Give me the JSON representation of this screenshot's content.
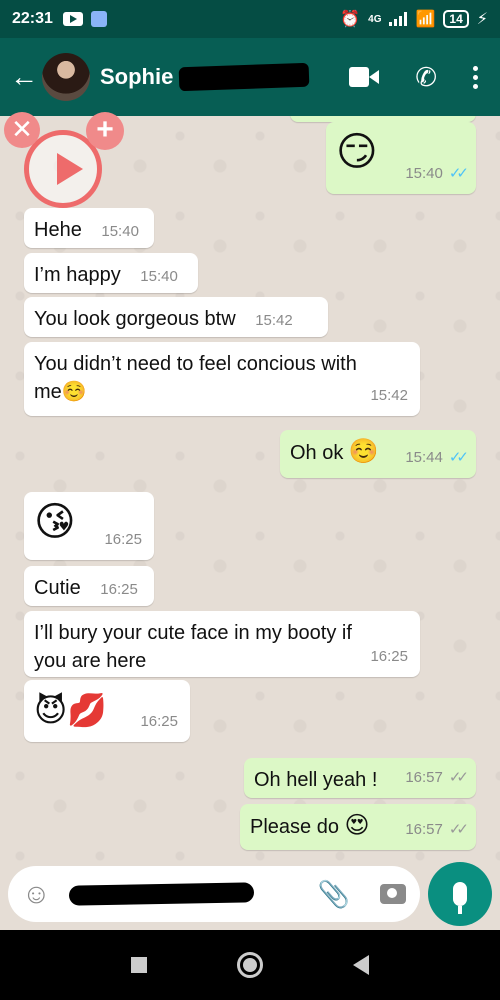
{
  "status_bar": {
    "time": "22:31",
    "network": "4G",
    "battery": "14"
  },
  "header": {
    "contact_name": "Sophie"
  },
  "messages": [
    {
      "dir": "out",
      "text": "😏",
      "time": "15:40",
      "ticks": "✓✓",
      "tick_color": "blue"
    },
    {
      "dir": "in",
      "text": "Hehe",
      "time": "15:40"
    },
    {
      "dir": "in",
      "text": "I’m happy",
      "time": "15:40"
    },
    {
      "dir": "in",
      "text": "You look gorgeous btw",
      "time": "15:42"
    },
    {
      "dir": "in",
      "text_line1": "You didn’t need to feel concious with",
      "text_line2": "me☺️",
      "time": "15:42"
    },
    {
      "dir": "out",
      "text": "Oh ok",
      "emoji": "☺️",
      "time": "15:44",
      "ticks": "✓✓",
      "tick_color": "blue"
    },
    {
      "dir": "in",
      "text": "😘",
      "time": "16:25"
    },
    {
      "dir": "in",
      "text": "Cutie",
      "time": "16:25"
    },
    {
      "dir": "in",
      "text_line1": "I’ll bury your cute face in my booty if",
      "text_line2": "you are here",
      "time": "16:25"
    },
    {
      "dir": "in",
      "text": "😈💋",
      "time": "16:25"
    },
    {
      "dir": "out",
      "text": "Oh hell yeah !",
      "time": "16:57",
      "ticks": "✓✓",
      "tick_color": "grey"
    },
    {
      "dir": "out",
      "text": "Please do",
      "emoji": "😍",
      "time": "16:57",
      "ticks": "✓✓",
      "tick_color": "grey"
    }
  ],
  "overlay": {
    "close_glyph": "✕",
    "add_glyph": "+"
  },
  "input": {
    "emoji_glyph": "☺",
    "clip_glyph": "📎"
  },
  "colors": {
    "header": "#075e54",
    "outgoing": "#dcf8c6",
    "incoming": "#ffffff",
    "accent": "#0a8f80",
    "tick_read": "#4fc3f7"
  }
}
